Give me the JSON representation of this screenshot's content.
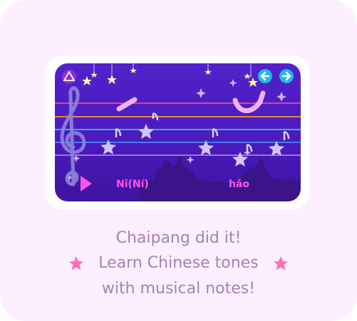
{
  "syllables": {
    "first": "Nǐ(Ní)",
    "second": "hǎo"
  },
  "caption": {
    "line1": "Chaipang did it!",
    "line2": "Learn Chinese tones",
    "line3": "with musical notes!"
  },
  "icons": {
    "home": "home-icon",
    "back": "arrow-left-icon",
    "forward": "arrow-right-icon",
    "play": "play-icon",
    "clef": "treble-clef-icon"
  },
  "colors": {
    "background": "#fcefff",
    "game_bg": "#4a1bbf",
    "caption_text": "#a482b8",
    "accent_pink": "#ff55e8",
    "nav_button": "#20b8e6",
    "caption_star": "#ff6fb8"
  }
}
